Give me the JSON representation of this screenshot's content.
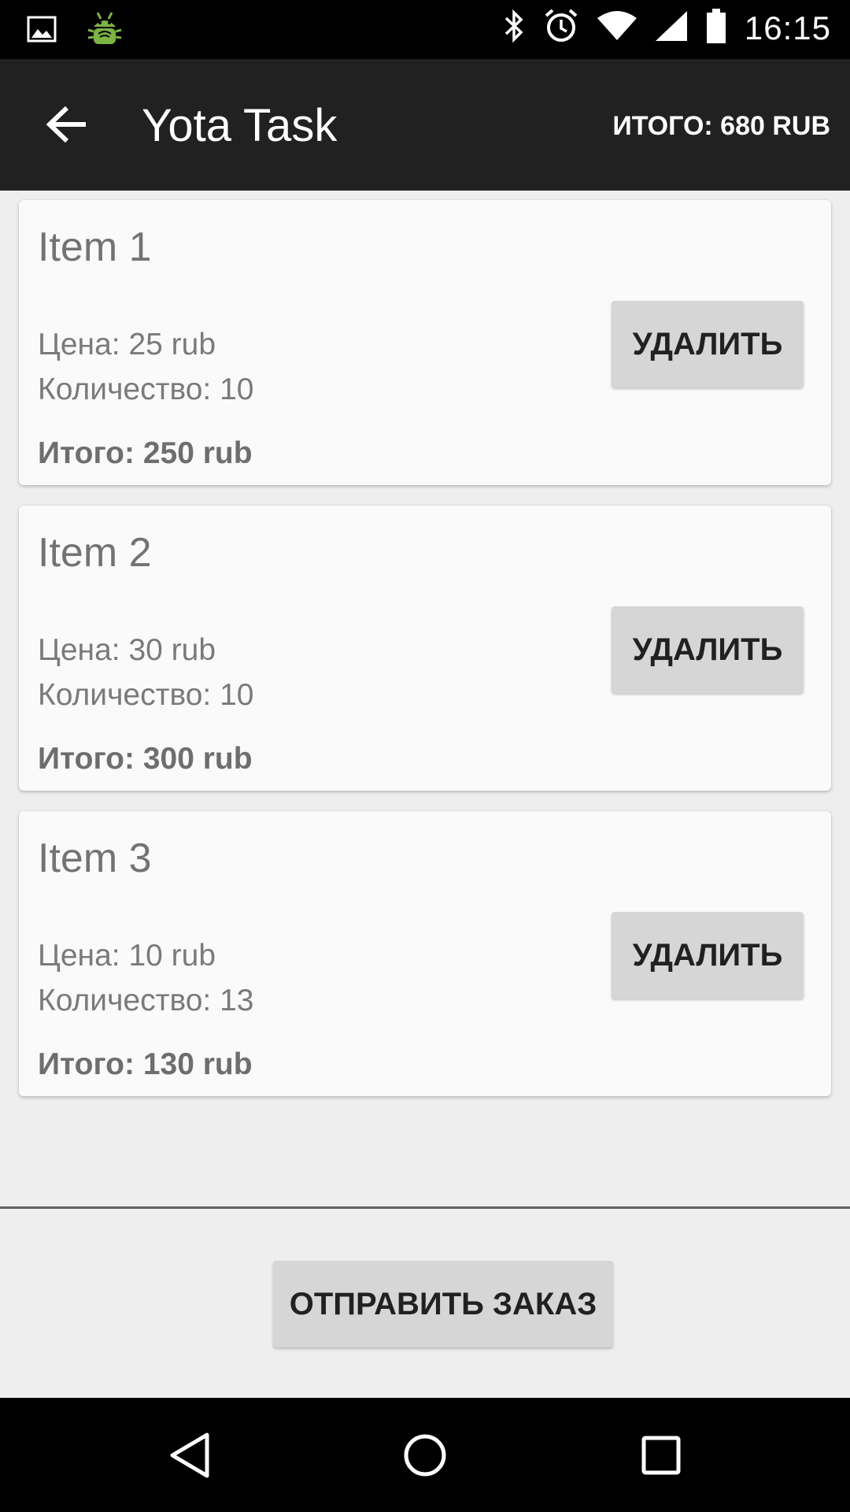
{
  "status_bar": {
    "time": "16:15",
    "icons": [
      "image-notification-icon",
      "android-debug-icon",
      "bluetooth-icon",
      "alarm-icon",
      "wifi-icon",
      "cell-signal-icon",
      "battery-icon"
    ]
  },
  "app_bar": {
    "title": "Yota Task",
    "total": "ИТОГО: 680 RUB"
  },
  "items": [
    {
      "title": "Item 1",
      "price": "Цена: 25 rub",
      "qty": "Количество: 10",
      "subtotal": "Итого: 250 rub",
      "delete_label": "УДАЛИТЬ"
    },
    {
      "title": "Item 2",
      "price": "Цена: 30 rub",
      "qty": "Количество: 10",
      "subtotal": "Итого: 300 rub",
      "delete_label": "УДАЛИТЬ"
    },
    {
      "title": "Item 3",
      "price": "Цена: 10 rub",
      "qty": "Количество: 13",
      "subtotal": "Итого: 130 rub",
      "delete_label": "УДАЛИТЬ"
    }
  ],
  "footer": {
    "submit_label": "ОТПРАВИТЬ ЗАКАЗ"
  },
  "nav_bar": {
    "icons": [
      "back-triangle-icon",
      "home-circle-icon",
      "recents-square-icon"
    ]
  },
  "colors": {
    "app_bar": "#212121",
    "background": "#eeeeee",
    "card": "#fafafa",
    "button": "#d6d6d6"
  }
}
